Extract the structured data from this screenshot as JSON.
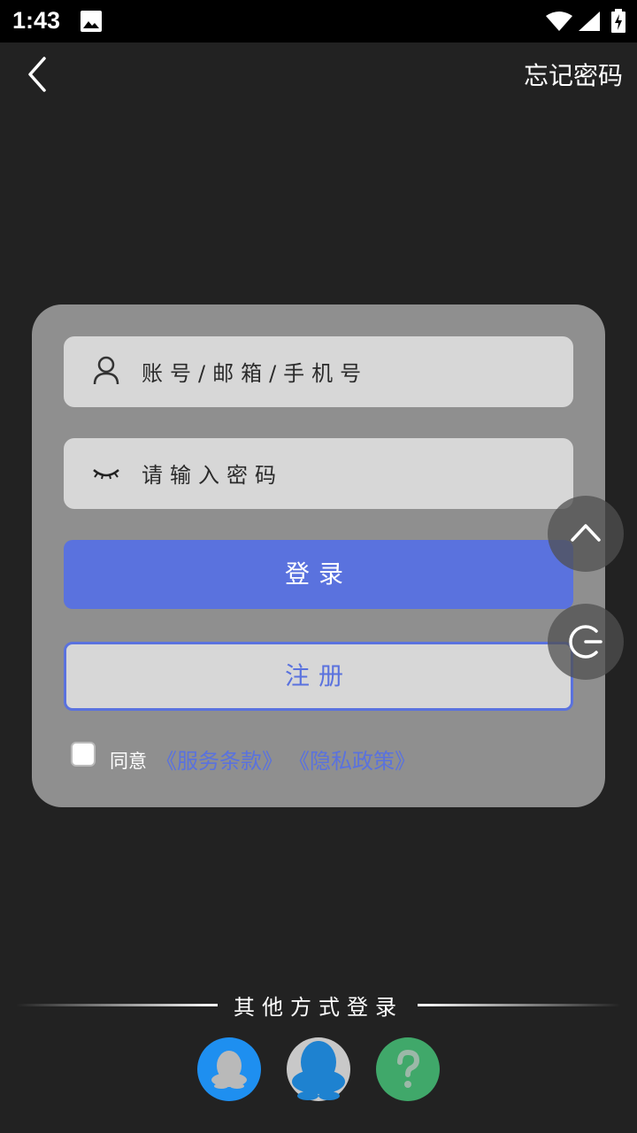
{
  "status_bar": {
    "time": "1:43"
  },
  "header": {
    "forgot_password": "忘记密码"
  },
  "form": {
    "account_placeholder": "账号/邮箱/手机号",
    "password_placeholder": "请输入密码",
    "login_label": "登录",
    "register_label": "注册",
    "agree_text": "同意",
    "terms_link": "《服务条款》",
    "privacy_link": "《隐私政策》",
    "agree_checked": false
  },
  "other_login": {
    "title": "其他方式登录"
  },
  "colors": {
    "accent": "#5a72de",
    "card": "#8f8f8f",
    "background": "#222222"
  },
  "icons": [
    "back-arrow-icon",
    "user-icon",
    "eye-closed-icon",
    "chevron-up-icon",
    "exit-icon",
    "qq-icon",
    "qq-large-icon",
    "help-icon"
  ]
}
